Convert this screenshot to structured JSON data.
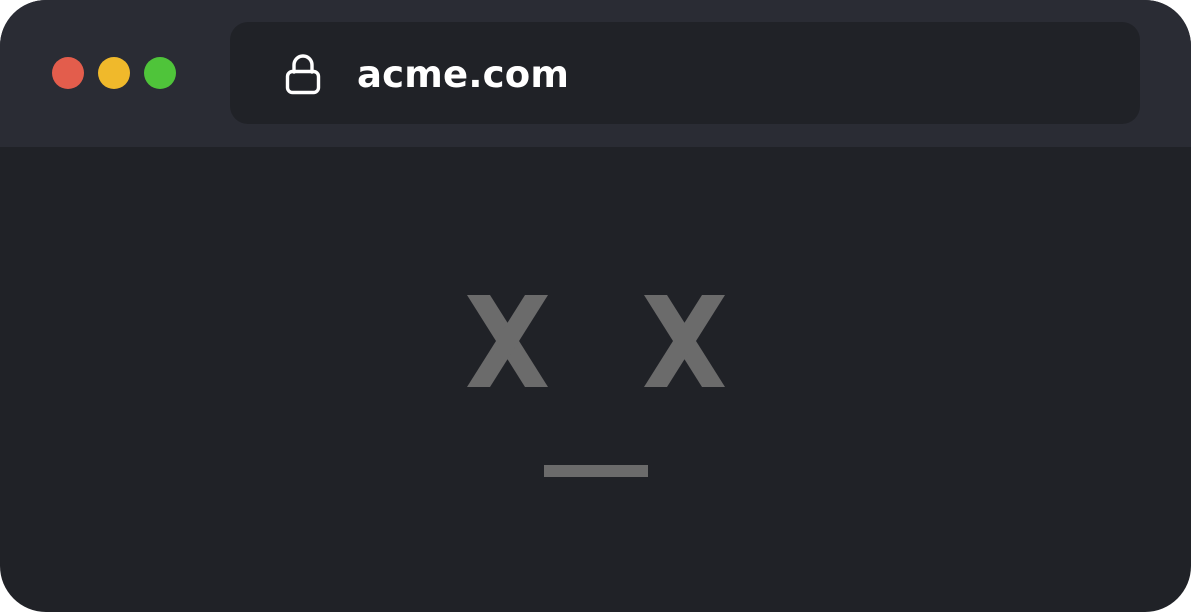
{
  "window": {
    "url": "acme.com",
    "address_bar_icon": "lock-icon",
    "traffic_lights": [
      {
        "name": "close",
        "color": "#e35d4c"
      },
      {
        "name": "minimize",
        "color": "#f0b92b"
      },
      {
        "name": "maximize",
        "color": "#4fc43a"
      }
    ]
  },
  "content": {
    "illustration": "dead-face-icon",
    "illustration_parts": [
      "left-x-eye",
      "right-x-eye",
      "flat-mouth"
    ],
    "illustration_color": "#6b6b6b"
  },
  "colors": {
    "title_bar": "#2a2c34",
    "page_background": "#202227",
    "url_text": "#ffffff"
  }
}
